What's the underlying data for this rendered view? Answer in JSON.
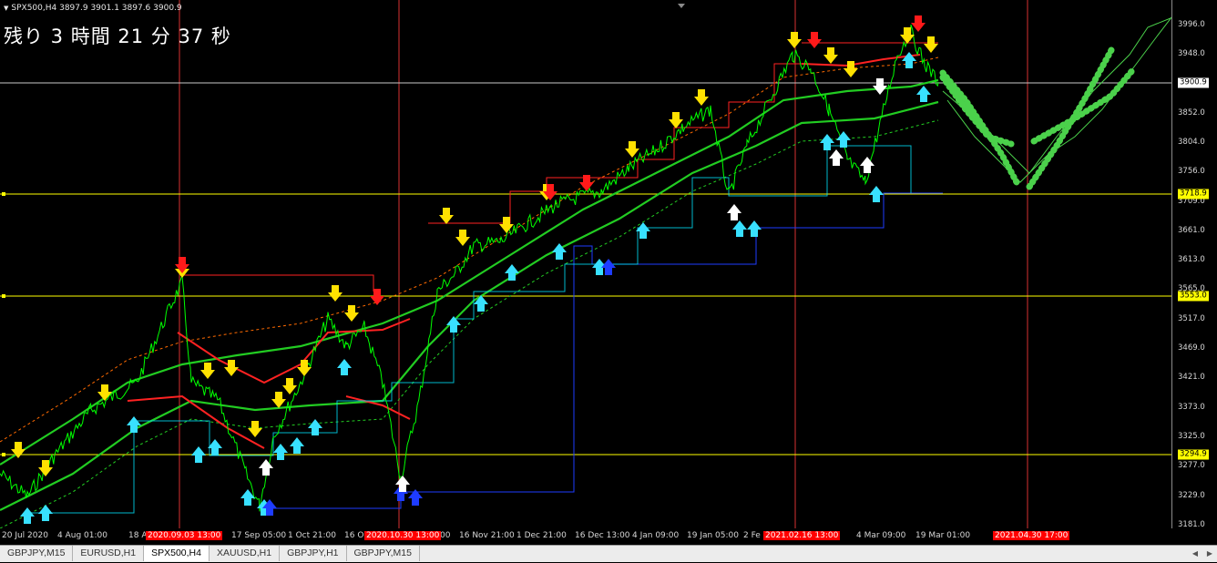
{
  "symbol_info": {
    "text": "SPX500,H4  3897.9 3901.1 3897.6 3900.9",
    "indicator": "triangle-down-icon"
  },
  "countdown": {
    "text": "残り 3 時間 21 分 37 秒"
  },
  "price_axis": {
    "labels": [
      "3996.0",
      "3948.0",
      "3900.9",
      "3852.0",
      "3804.0",
      "3756.0",
      "3709.0",
      "3661.0",
      "3613.0",
      "3565.0",
      "3517.0",
      "3469.0",
      "3421.0",
      "3373.0",
      "3325.0",
      "3277.0",
      "3229.0",
      "3181.0"
    ],
    "badges": [
      {
        "text": "3900.9",
        "bg": "#ffffff",
        "color": "#000000"
      },
      {
        "text": "3718.9",
        "bg": "#ffff00",
        "color": "#000000"
      },
      {
        "text": "3553.0",
        "bg": "#ffff00",
        "color": "#000000"
      },
      {
        "text": "3294.9",
        "bg": "#ffff00",
        "color": "#000000"
      }
    ]
  },
  "time_axis": {
    "labels": [
      "20 Jul 2020",
      "4 Aug 01:00",
      "18 Aug",
      "17 Sep 05:00",
      "1 Oct 21:00",
      "16 O",
      ":00",
      "16 Nov 21:00",
      "1 Dec 21:00",
      "16 Dec 13:00",
      "4 Jan 09:00",
      "19 Jan 05:00",
      "2 Fe",
      "17:00",
      "4 Mar 09:00",
      "19 Mar 01:00"
    ],
    "badges": [
      {
        "text": "2020.09.03 13:00",
        "bg": "#ff0000",
        "color": "#ffffff"
      },
      {
        "text": "2020.10.30 13:00",
        "bg": "#ff0000",
        "color": "#ffffff"
      },
      {
        "text": "2021.02.16 13:00",
        "bg": "#ff0000",
        "color": "#ffffff"
      },
      {
        "text": "2021.04.30 17:00",
        "bg": "#ff0000",
        "color": "#ffffff"
      }
    ]
  },
  "tabs": [
    {
      "label": "GBPJPY,M15",
      "active": false
    },
    {
      "label": "EURUSD,H1",
      "active": false
    },
    {
      "label": "SPX500,H4",
      "active": true
    },
    {
      "label": "XAUUSD,H1",
      "active": false
    },
    {
      "label": "GBPJPY,H1",
      "active": false
    },
    {
      "label": "GBPJPY,M15",
      "active": false
    }
  ],
  "tab_scroll": {
    "left": "◀",
    "right": "▶"
  },
  "colors": {
    "background": "#000000",
    "price_line": "#00ff00",
    "trend_band": "#22cc22",
    "resistance": "#ff2222",
    "support_blue": "#1e3cff",
    "support_cyan": "#00e5ff",
    "sell_arrow": "#ffe100",
    "sell_arrow_red": "#ff1a1a",
    "buy_arrow": "#38e0ff",
    "buy_arrow_white": "#ffffff",
    "horizontal_level": "#ffff00",
    "current_price_line": "#c8c8c8",
    "vertical_marker": "#ff3b3b",
    "forecast": "#4bd14b"
  }
}
